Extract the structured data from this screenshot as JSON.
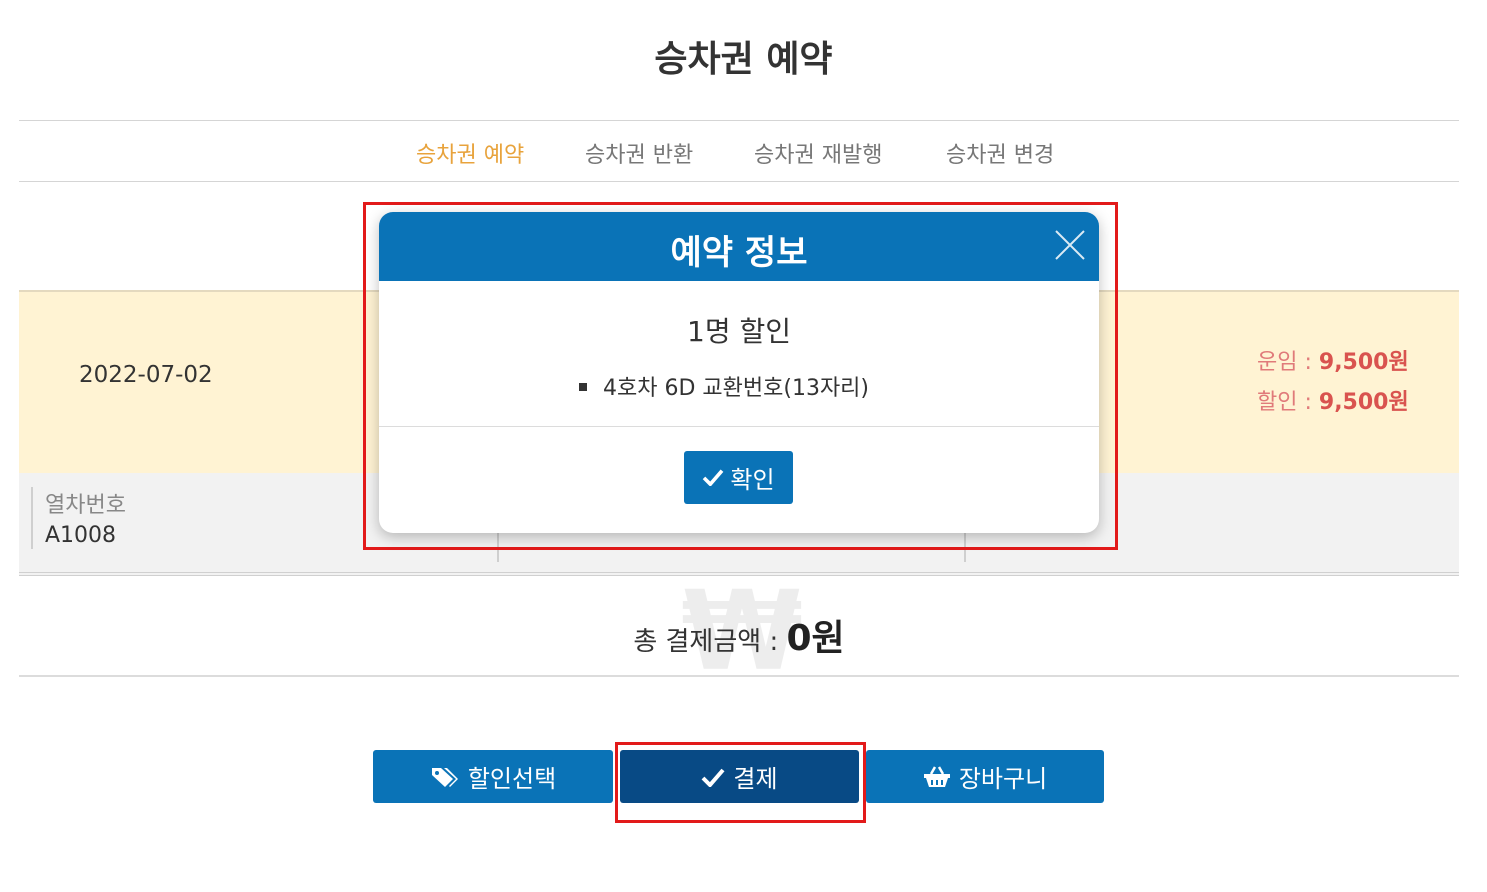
{
  "page": {
    "title": "승차권 예약"
  },
  "tabs": [
    {
      "label": "승차권 예약",
      "active": true
    },
    {
      "label": "승차권 반환",
      "active": false
    },
    {
      "label": "승차권 재발행",
      "active": false
    },
    {
      "label": "승차권 변경",
      "active": false
    }
  ],
  "trip": {
    "date": "2022-07-02",
    "fare_label": "운임 :",
    "fare_value": "9,500원",
    "discount_label": "할인 :",
    "discount_value": "9,500원"
  },
  "info": {
    "train_label": "열차번호",
    "train_value": "A1008"
  },
  "total": {
    "label": "총 결제금액 :",
    "value": "0원"
  },
  "buttons": {
    "discount": {
      "label": "할인선택",
      "icon": "tags-icon"
    },
    "pay": {
      "label": "결제",
      "icon": "check-icon"
    },
    "cart": {
      "label": "장바구니",
      "icon": "basket-icon"
    }
  },
  "modal": {
    "title": "예약 정보",
    "heading": "1명 할인",
    "item": "4호차 6D 교환번호(13자리)",
    "ok_label": "확인"
  },
  "colors": {
    "primary": "#0a73b7",
    "primary_dark": "#084a85",
    "active_tab": "#e8a33c",
    "fare_amount": "#d9534f",
    "trip_band": "#fff3d3",
    "highlight": "#e21a1a"
  }
}
